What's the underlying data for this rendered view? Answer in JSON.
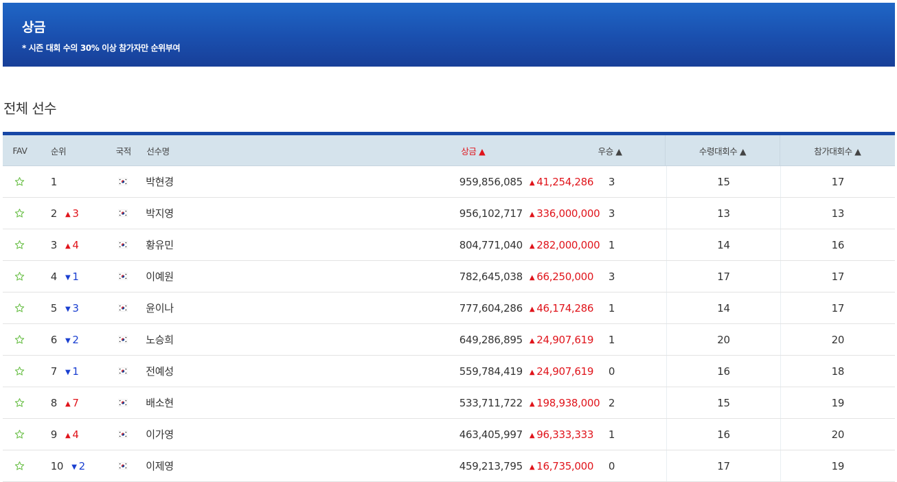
{
  "banner": {
    "title": "상금",
    "subtitle": "* 시즌 대회 수의 30% 이상 참가자만 순위부여"
  },
  "section_title": "전체 선수",
  "columns": {
    "fav": "FAV",
    "rank": "순위",
    "nationality": "국적",
    "name": "선수명",
    "prize": "상금 ▲",
    "wins": "우승 ▲",
    "cuts_made": "수령대회수 ▲",
    "events_played": "참가대회수 ▲"
  },
  "colors": {
    "banner": "#1a4fae",
    "up": "#e0141b",
    "down": "#1a3fd0",
    "star": "#6cc04a",
    "header_bg": "#d5e3ec"
  },
  "rows": [
    {
      "rank": "1",
      "move_dir": "none",
      "move": "",
      "flag": "KOR",
      "name": "박현경",
      "prize": "959,856,085",
      "prize_diff": "41,254,286",
      "wins": "3",
      "cuts": "15",
      "played": "17"
    },
    {
      "rank": "2",
      "move_dir": "up",
      "move": "3",
      "flag": "KOR",
      "name": "박지영",
      "prize": "956,102,717",
      "prize_diff": "336,000,000",
      "wins": "3",
      "cuts": "13",
      "played": "13"
    },
    {
      "rank": "3",
      "move_dir": "up",
      "move": "4",
      "flag": "KOR",
      "name": "황유민",
      "prize": "804,771,040",
      "prize_diff": "282,000,000",
      "wins": "1",
      "cuts": "14",
      "played": "16"
    },
    {
      "rank": "4",
      "move_dir": "down",
      "move": "1",
      "flag": "KOR",
      "name": "이예원",
      "prize": "782,645,038",
      "prize_diff": "66,250,000",
      "wins": "3",
      "cuts": "17",
      "played": "17"
    },
    {
      "rank": "5",
      "move_dir": "down",
      "move": "3",
      "flag": "KOR",
      "name": "윤이나",
      "prize": "777,604,286",
      "prize_diff": "46,174,286",
      "wins": "1",
      "cuts": "14",
      "played": "17"
    },
    {
      "rank": "6",
      "move_dir": "down",
      "move": "2",
      "flag": "KOR",
      "name": "노승희",
      "prize": "649,286,895",
      "prize_diff": "24,907,619",
      "wins": "1",
      "cuts": "20",
      "played": "20"
    },
    {
      "rank": "7",
      "move_dir": "down",
      "move": "1",
      "flag": "KOR",
      "name": "전예성",
      "prize": "559,784,419",
      "prize_diff": "24,907,619",
      "wins": "0",
      "cuts": "16",
      "played": "18"
    },
    {
      "rank": "8",
      "move_dir": "up",
      "move": "7",
      "flag": "KOR",
      "name": "배소현",
      "prize": "533,711,722",
      "prize_diff": "198,938,000",
      "wins": "2",
      "cuts": "15",
      "played": "19"
    },
    {
      "rank": "9",
      "move_dir": "up",
      "move": "4",
      "flag": "KOR",
      "name": "이가영",
      "prize": "463,405,997",
      "prize_diff": "96,333,333",
      "wins": "1",
      "cuts": "16",
      "played": "20"
    },
    {
      "rank": "10",
      "move_dir": "down",
      "move": "2",
      "flag": "KOR",
      "name": "이제영",
      "prize": "459,213,795",
      "prize_diff": "16,735,000",
      "wins": "0",
      "cuts": "17",
      "played": "19"
    }
  ]
}
